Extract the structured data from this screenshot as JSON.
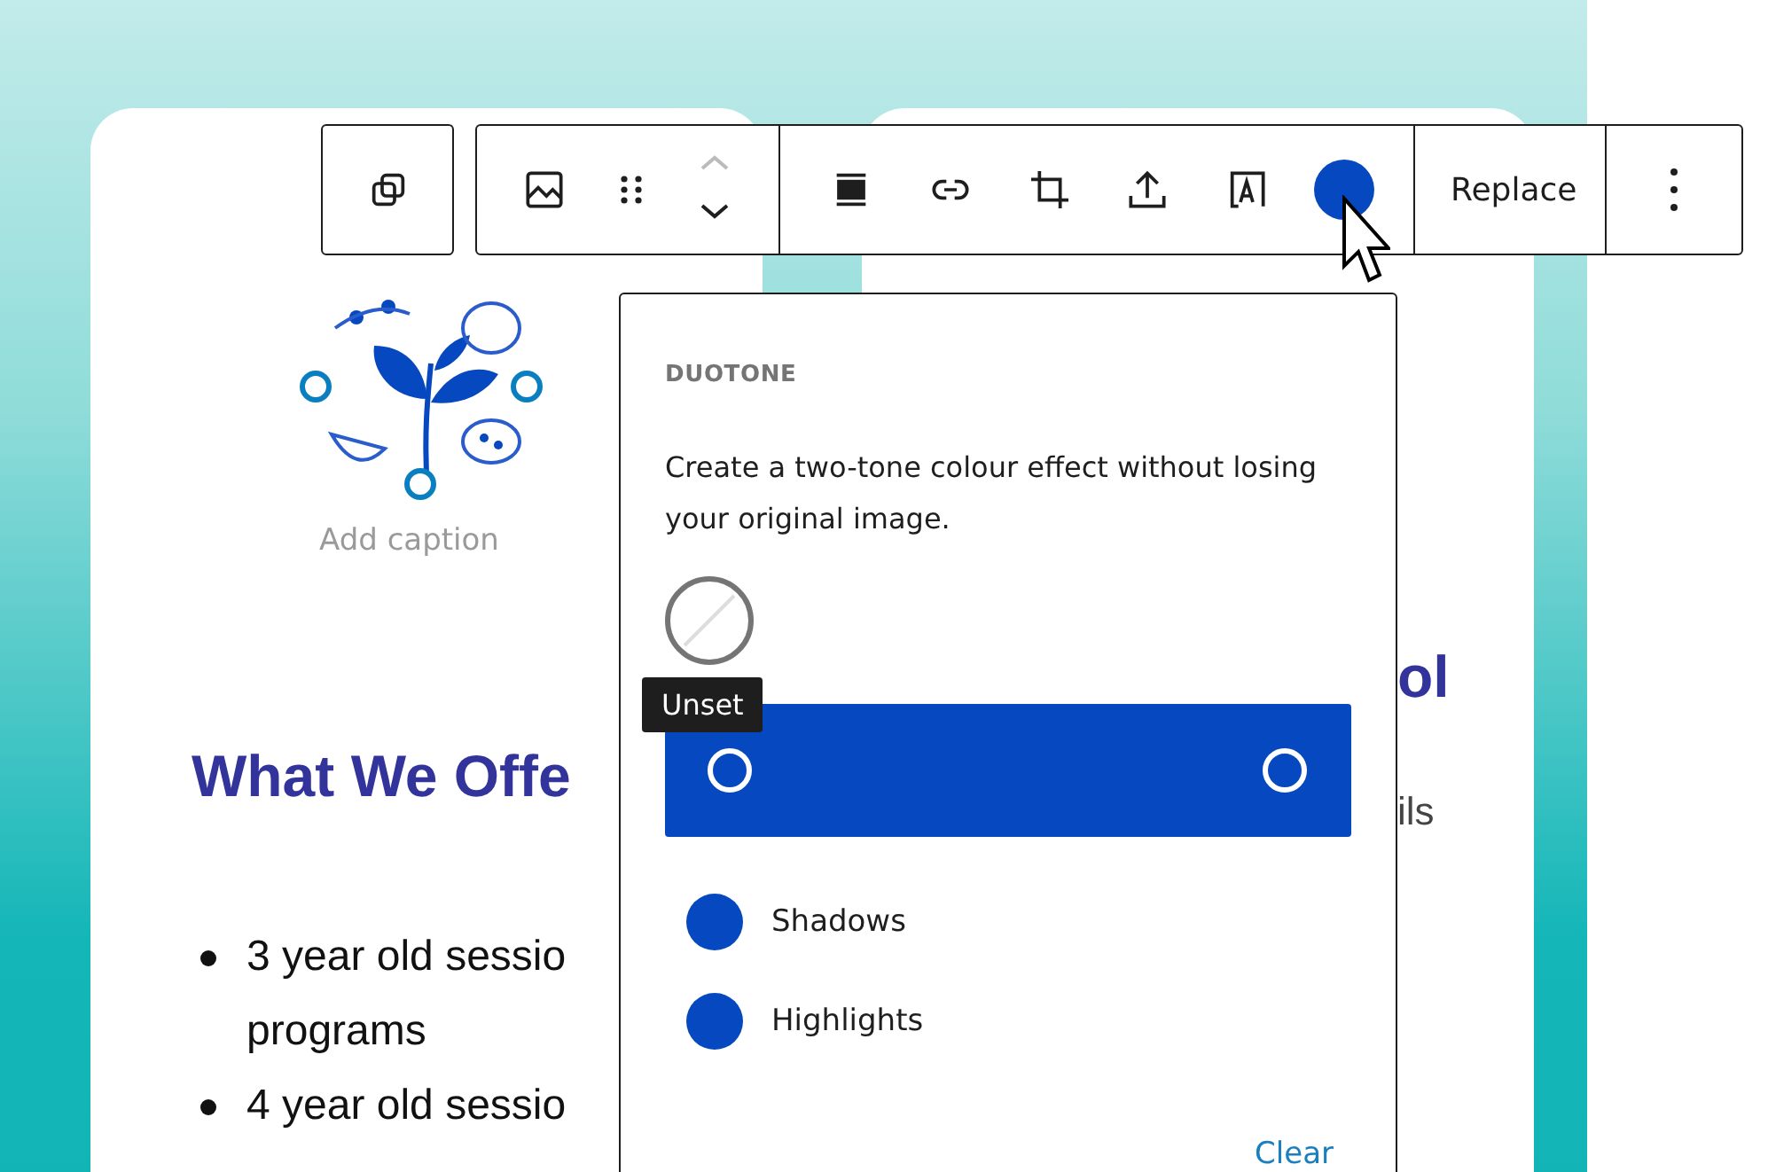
{
  "toolbar": {
    "replace_label": "Replace"
  },
  "left_card": {
    "caption": "Add caption",
    "heading": "What We Offe",
    "list": [
      {
        "lines": [
          "3 year old sessio",
          "programs"
        ]
      },
      {
        "lines": [
          "4 year old sessio"
        ]
      }
    ]
  },
  "right_card": {
    "heading": "ol",
    "text": "ils"
  },
  "duotone_popover": {
    "title": "DUOTONE",
    "description": "Create a two-tone colour effect without losing your original image.",
    "unset_tooltip": "Unset",
    "tones": [
      {
        "label": "Shadows",
        "color": "#0548c0"
      },
      {
        "label": "Highlights",
        "color": "#0548c0"
      }
    ],
    "clear_label": "Clear"
  }
}
